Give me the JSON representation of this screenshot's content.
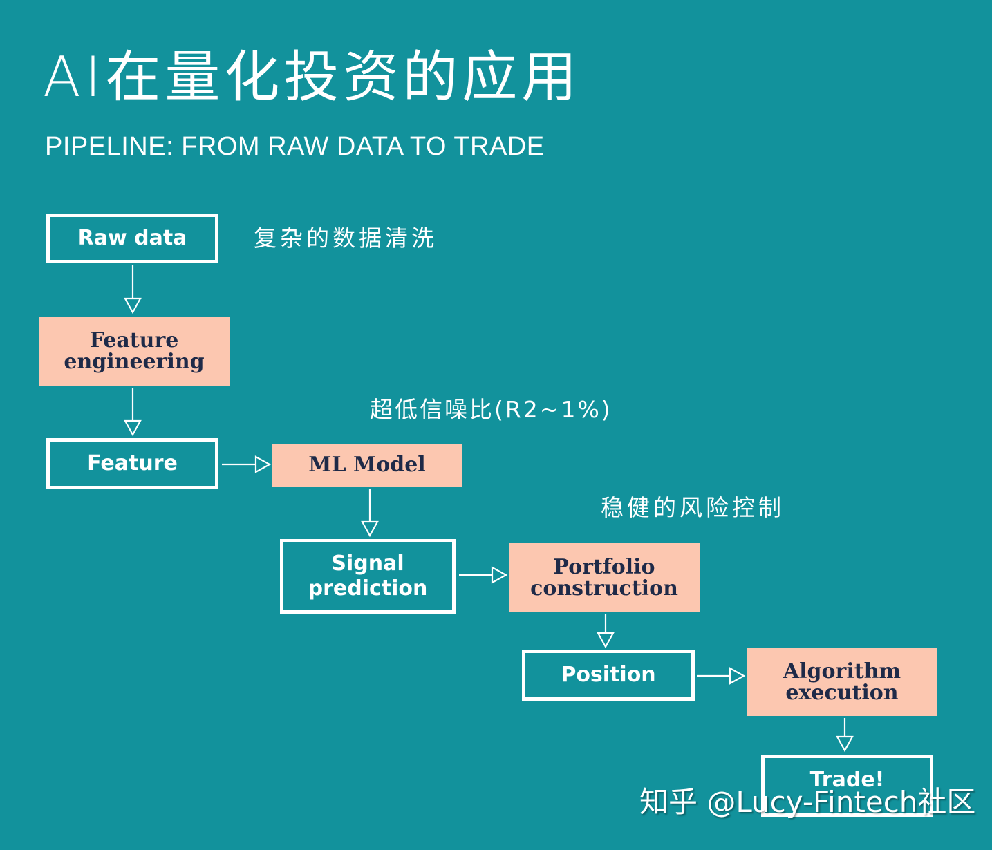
{
  "header": {
    "title": "AI在量化投资的应用",
    "subtitle": "PIPELINE: FROM RAW DATA TO TRADE"
  },
  "colors": {
    "background": "#12929c",
    "outline_node": "#ffffff",
    "filled_node": "#fcc7b0",
    "filled_text": "#1e2a48"
  },
  "nodes": [
    {
      "id": "raw-data",
      "label": "Raw data",
      "style": "outline"
    },
    {
      "id": "feature-engineering",
      "label": "Feature\nengineering",
      "style": "filled"
    },
    {
      "id": "feature",
      "label": "Feature",
      "style": "outline"
    },
    {
      "id": "ml-model",
      "label": "ML Model",
      "style": "filled"
    },
    {
      "id": "signal-prediction",
      "label": "Signal\nprediction",
      "style": "outline"
    },
    {
      "id": "portfolio-construction",
      "label": "Portfolio\nconstruction",
      "style": "filled"
    },
    {
      "id": "position",
      "label": "Position",
      "style": "outline"
    },
    {
      "id": "algorithm-execution",
      "label": "Algorithm\nexecution",
      "style": "filled"
    },
    {
      "id": "trade",
      "label": "Trade!",
      "style": "outline"
    }
  ],
  "edges": [
    {
      "from": "raw-data",
      "to": "feature-engineering"
    },
    {
      "from": "feature-engineering",
      "to": "feature"
    },
    {
      "from": "feature",
      "to": "ml-model"
    },
    {
      "from": "ml-model",
      "to": "signal-prediction"
    },
    {
      "from": "signal-prediction",
      "to": "portfolio-construction"
    },
    {
      "from": "portfolio-construction",
      "to": "position"
    },
    {
      "from": "position",
      "to": "algorithm-execution"
    },
    {
      "from": "algorithm-execution",
      "to": "trade"
    }
  ],
  "annotations": {
    "data_cleaning": "复杂的数据清洗",
    "low_snr": "超低信噪比(R2~1%)",
    "risk_control": "稳健的风险控制"
  },
  "watermark": "知乎 @Lucy-Fintech社区"
}
